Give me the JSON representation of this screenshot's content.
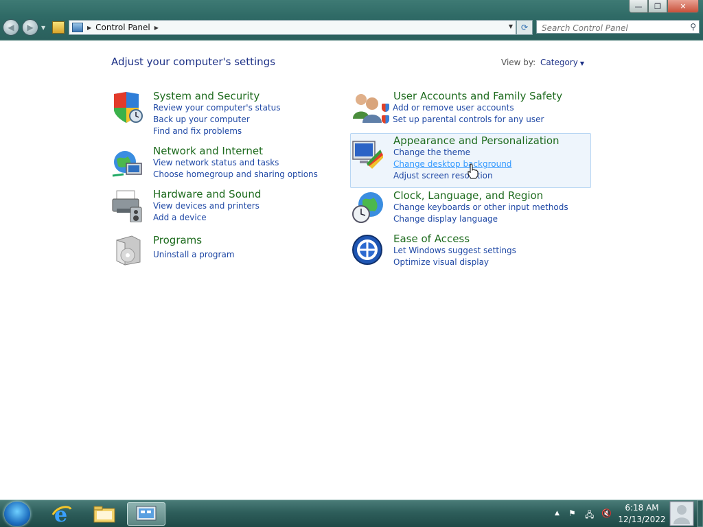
{
  "window": {
    "controls": {
      "minimize": "—",
      "maximize": "❐",
      "close": "✕"
    }
  },
  "address_bar": {
    "breadcrumb": "Control Panel",
    "back_icon": "back-arrow-icon",
    "forward_icon": "forward-arrow-icon"
  },
  "search": {
    "placeholder": "Search Control Panel"
  },
  "content": {
    "heading": "Adjust your computer's settings",
    "view_by_label": "View by:",
    "view_by_value": "Category"
  },
  "categories": [
    {
      "title": "System and Security",
      "icon": "shield-clock-icon",
      "links": [
        "Review your computer's status",
        "Back up your computer",
        "Find and fix problems"
      ]
    },
    {
      "title": "Network and Internet",
      "icon": "network-globe-icon",
      "links": [
        "View network status and tasks",
        "Choose homegroup and sharing options"
      ]
    },
    {
      "title": "Hardware and Sound",
      "icon": "printer-speaker-icon",
      "links": [
        "View devices and printers",
        "Add a device"
      ]
    },
    {
      "title": "Programs",
      "icon": "programs-box-icon",
      "links": [
        "Uninstall a program"
      ]
    },
    {
      "title": "User Accounts and Family Safety",
      "icon": "users-icon",
      "links": [
        "Add or remove user accounts",
        "Set up parental controls for any user"
      ]
    },
    {
      "title": "Appearance and Personalization",
      "icon": "monitor-colors-icon",
      "links": [
        "Change the theme",
        "Change desktop background",
        "Adjust screen resolution"
      ]
    },
    {
      "title": "Clock, Language, and Region",
      "icon": "globe-clock-icon",
      "links": [
        "Change keyboards or other input methods",
        "Change display language"
      ]
    },
    {
      "title": "Ease of Access",
      "icon": "ease-of-access-icon",
      "links": [
        "Let Windows suggest settings",
        "Optimize visual display"
      ]
    }
  ],
  "taskbar": {
    "items": [
      "start-orb-icon",
      "internet-explorer-icon",
      "windows-explorer-icon",
      "control-panel-icon"
    ],
    "tray_icons": [
      "show-hidden-icons",
      "action-center-flag-icon",
      "network-icon",
      "volume-muted-icon"
    ],
    "time": "6:18 AM",
    "date": "12/13/2022"
  },
  "colors": {
    "link": "#1f48a5",
    "category_title": "#1e6b1e",
    "heading": "#1e3287",
    "hover_link": "#3399ff"
  }
}
